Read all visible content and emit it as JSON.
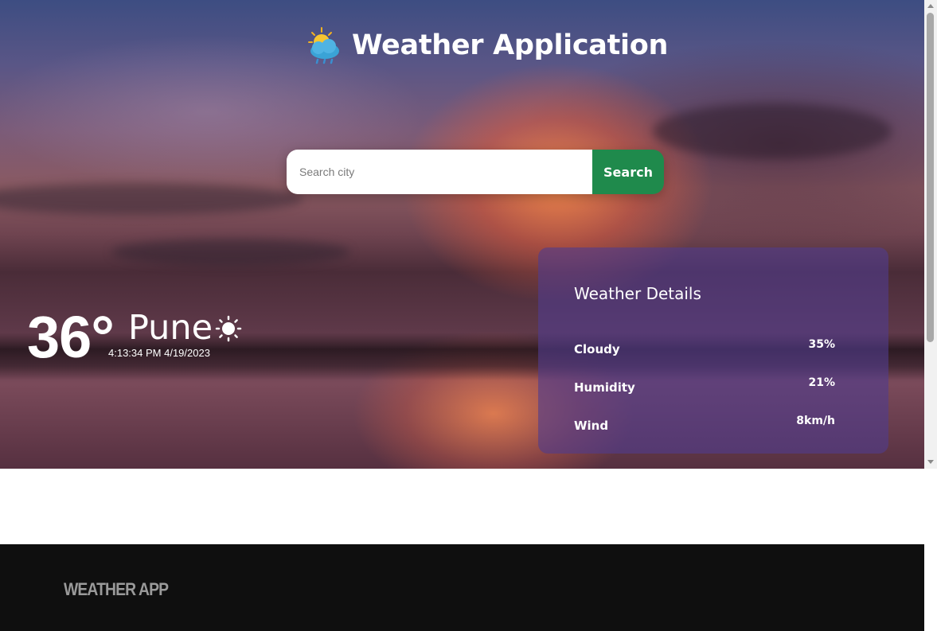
{
  "header": {
    "title": "Weather Application",
    "icon": "sun-behind-rain-cloud-icon"
  },
  "search": {
    "placeholder": "Search city",
    "value": "",
    "button_label": "Search"
  },
  "current": {
    "temperature": "36°",
    "city": "Pune",
    "condition_icon": "sun-icon",
    "datetime": "4:13:34 PM 4/19/2023"
  },
  "details": {
    "title": "Weather Details",
    "rows": [
      {
        "label": "Cloudy",
        "value": "35%"
      },
      {
        "label": "Humidity",
        "value": "21%"
      },
      {
        "label": "Wind",
        "value": "8km/h"
      }
    ]
  },
  "footer": {
    "brand": "WEATHER APP"
  },
  "colors": {
    "search_button": "#1f8a4c",
    "details_panel": "#503c8c",
    "footer_bg": "#0f0f0f",
    "footer_text": "#9a9a9a"
  }
}
